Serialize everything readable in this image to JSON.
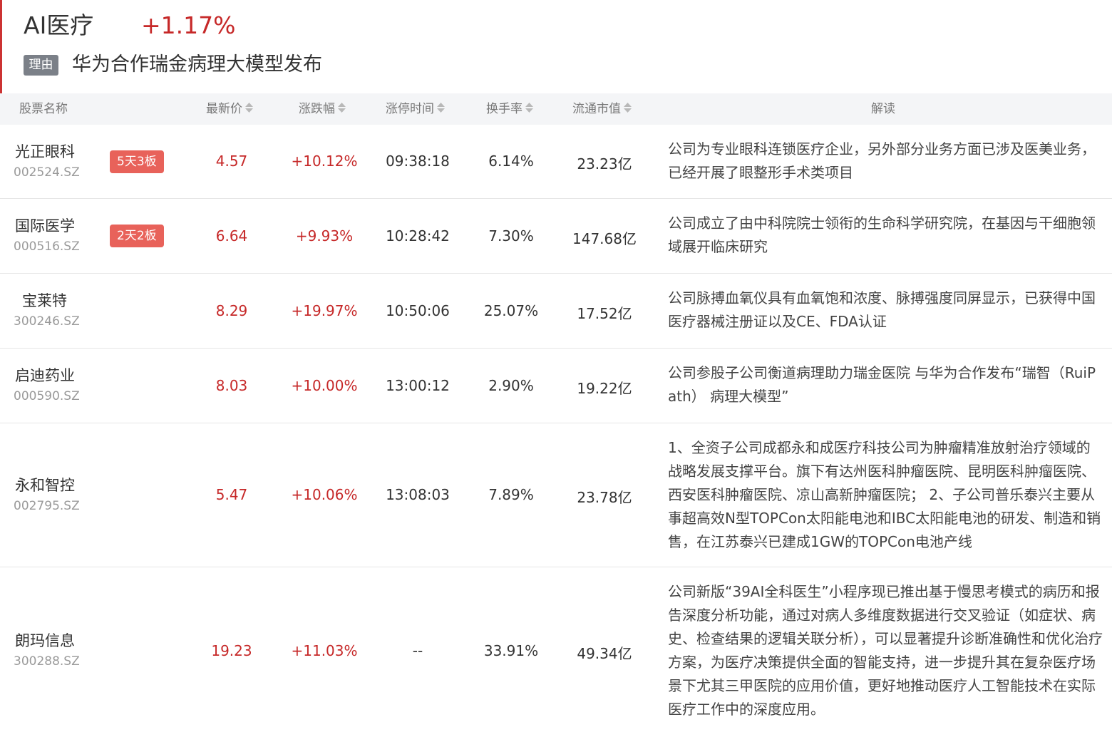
{
  "sector": {
    "name": "AI医疗",
    "change": "+1.17%",
    "reason_label": "理由",
    "reason_text": "华为合作瑞金病理大模型发布"
  },
  "table": {
    "headers": {
      "name": "股票名称",
      "price": "最新价",
      "change": "涨跌幅",
      "limit_time": "涨停时间",
      "turnover": "换手率",
      "market_cap": "流通市值",
      "analysis": "解读"
    },
    "rows": [
      {
        "name": "光正眼科",
        "code": "002524.SZ",
        "streak": "5天3板",
        "price": "4.57",
        "change": "+10.12%",
        "limit_time": "09:38:18",
        "turnover": "6.14%",
        "market_cap": "23.23亿",
        "analysis": "公司为专业眼科连锁医疗企业，另外部分业务方面已涉及医美业务，已经开展了眼整形手术类项目"
      },
      {
        "name": "国际医学",
        "code": "000516.SZ",
        "streak": "2天2板",
        "price": "6.64",
        "change": "+9.93%",
        "limit_time": "10:28:42",
        "turnover": "7.30%",
        "market_cap": "147.68亿",
        "analysis": "公司成立了由中科院院士领衔的生命科学研究院，在基因与干细胞领域展开临床研究"
      },
      {
        "name": "宝莱特",
        "code": "300246.SZ",
        "streak": "",
        "price": "8.29",
        "change": "+19.97%",
        "limit_time": "10:50:06",
        "turnover": "25.07%",
        "market_cap": "17.52亿",
        "analysis": "公司脉搏血氧仪具有血氧饱和浓度、脉搏强度同屏显示，已获得中国医疗器械注册证以及CE、FDA认证"
      },
      {
        "name": "启迪药业",
        "code": "000590.SZ",
        "streak": "",
        "price": "8.03",
        "change": "+10.00%",
        "limit_time": "13:00:12",
        "turnover": "2.90%",
        "market_cap": "19.22亿",
        "analysis": "公司参股子公司衡道病理助力瑞金医院 与华为合作发布“瑞智（RuiPath） 病理大模型”"
      },
      {
        "name": "永和智控",
        "code": "002795.SZ",
        "streak": "",
        "price": "5.47",
        "change": "+10.06%",
        "limit_time": "13:08:03",
        "turnover": "7.89%",
        "market_cap": "23.78亿",
        "analysis": "1、全资子公司成都永和成医疗科技公司为肿瘤精准放射治疗领域的战略发展支撑平台。旗下有达州医科肿瘤医院、昆明医科肿瘤医院、西安医科肿瘤医院、凉山高新肿瘤医院； 2、子公司普乐泰兴主要从事超高效N型TOPCon太阳能电池和IBC太阳能电池的研发、制造和销售，在江苏泰兴已建成1GW的TOPCon电池产线"
      },
      {
        "name": "朗玛信息",
        "code": "300288.SZ",
        "streak": "",
        "price": "19.23",
        "change": "+11.03%",
        "limit_time": "--",
        "turnover": "33.91%",
        "market_cap": "49.34亿",
        "analysis": "公司新版“39AI全科医生”小程序现已推出基于慢思考模式的病历和报告深度分析功能，通过对病人多维度数据进行交叉验证（如症状、病史、检查结果的逻辑关联分析），可以显著提升诊断准确性和优化治疗方案，为医疗决策提供全面的智能支持，进一步提升其在复杂医疗场景下尤其三甲医院的应用价值，更好地推动医疗人工智能技术在实际医疗工作中的深度应用。"
      }
    ]
  },
  "colors": {
    "up": "#c62828",
    "badge": "#e8625a",
    "reason_badge": "#7b8088",
    "header_bg": "#f4f5f7"
  },
  "icons": {
    "sort": "sort-updown-icon"
  }
}
